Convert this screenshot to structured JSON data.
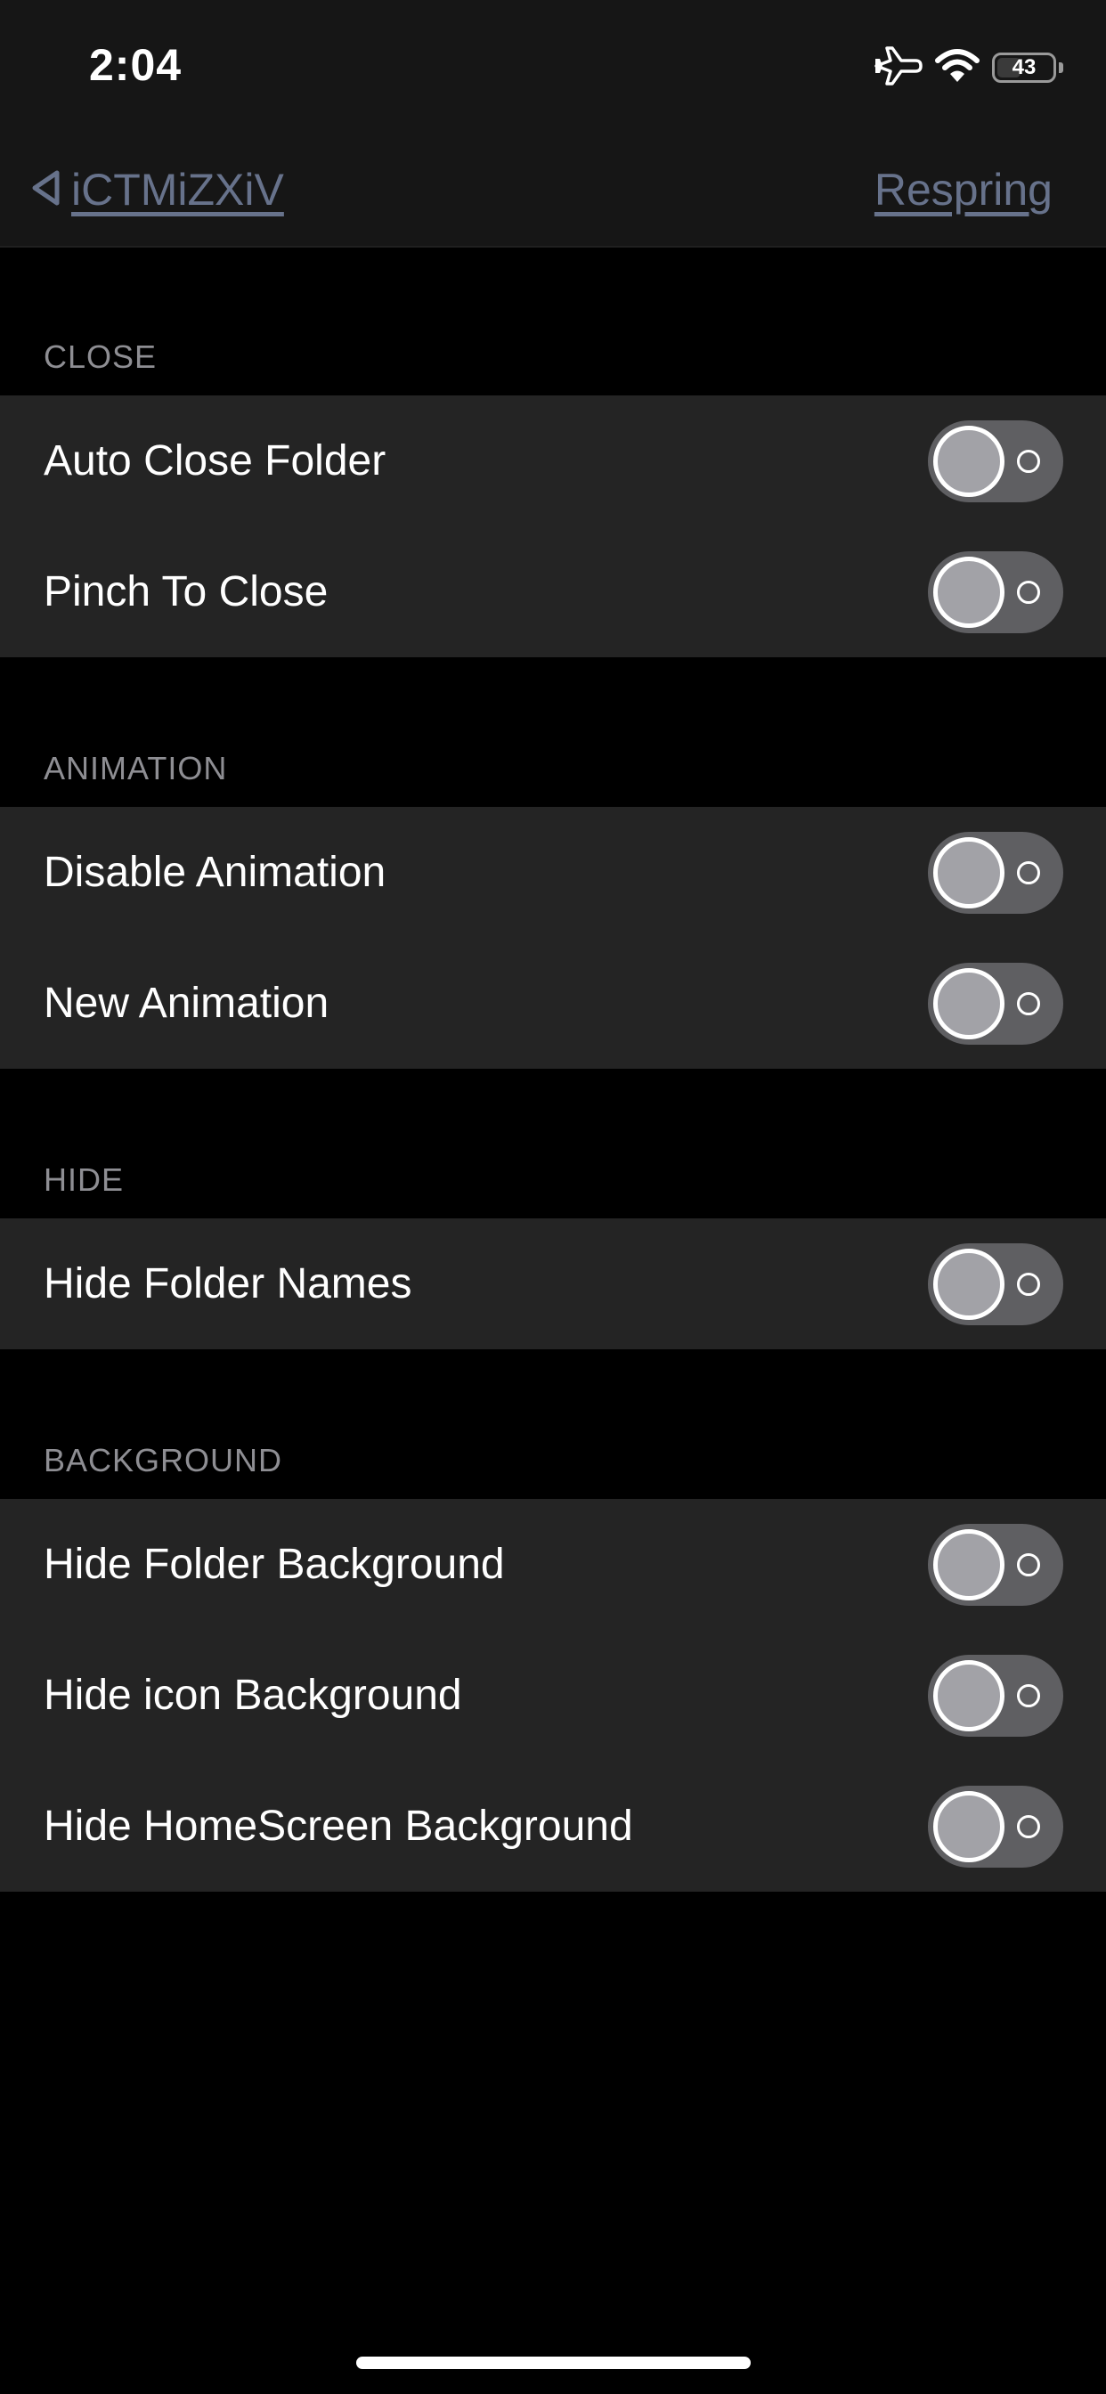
{
  "status_bar": {
    "time": "2:04",
    "battery_level": "43",
    "battery_fraction": 0.43,
    "icons": [
      "airplane-icon",
      "wifi-icon",
      "battery-icon"
    ]
  },
  "nav": {
    "back_label": "iCTMiZXiV",
    "right_button_label": "Respring"
  },
  "colors": {
    "background": "#000000",
    "bar": "#161616",
    "cell": "#242424",
    "link": "#67728b",
    "section_header": "#8e8e93",
    "toggle_off_track": "#5f5f62"
  },
  "sections": [
    {
      "header": "CLOSE",
      "rows": [
        {
          "label": "Auto Close Folder",
          "on": false
        },
        {
          "label": "Pinch To Close",
          "on": false
        }
      ]
    },
    {
      "header": "ANIMATION",
      "rows": [
        {
          "label": "Disable Animation",
          "on": false
        },
        {
          "label": "New Animation",
          "on": false
        }
      ]
    },
    {
      "header": "HIDE",
      "rows": [
        {
          "label": "Hide Folder Names",
          "on": false
        }
      ]
    },
    {
      "header": "BACKGROUND",
      "rows": [
        {
          "label": "Hide Folder Background",
          "on": false
        },
        {
          "label": "Hide icon Background",
          "on": false
        },
        {
          "label": "Hide HomeScreen Background",
          "on": false
        }
      ]
    }
  ]
}
